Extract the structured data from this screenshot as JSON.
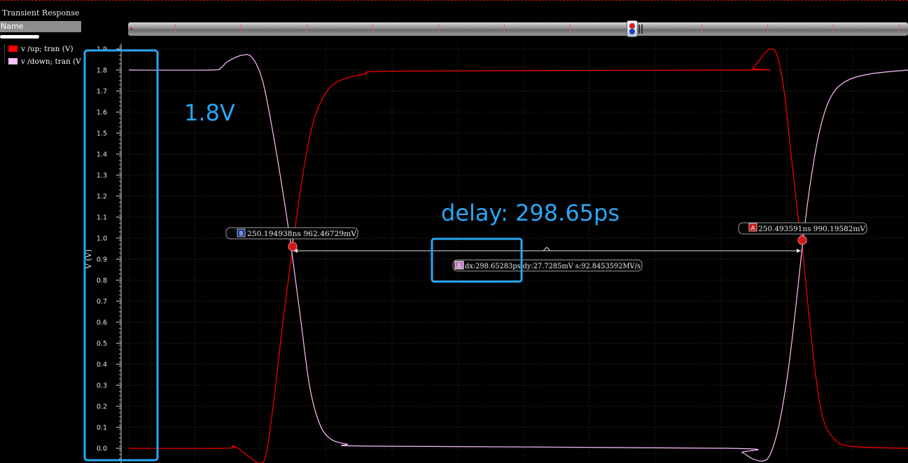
{
  "window": {
    "title": "Transient Response"
  },
  "legend": {
    "header": "Name",
    "items": [
      {
        "label": "v /up; tran (V)",
        "color": "#ff0000"
      },
      {
        "label": "v /down; tran (V",
        "color": "#ffc0ff"
      }
    ]
  },
  "annotations": {
    "voltage_label": "1.8V",
    "delay_label": "delay: 298.65ps"
  },
  "markers": {
    "B": {
      "letter": "B",
      "text": "250.194938ns 962.46729mV",
      "color": "#1a3a9c"
    },
    "A": {
      "letter": "A",
      "text": "250.493591ns 990.19582mV",
      "color": "#cc1a1a"
    },
    "delta": {
      "letter": "Δ",
      "text": "dx:298.65283ps dy:27.7285mV s:92.8453592MV/s",
      "color": "#c070c0"
    }
  },
  "colors": {
    "background": "#000000",
    "up": "#ff0000",
    "down": "#ffc0ff",
    "annotation": "#2aa7f5",
    "grid": "#3a3a3a"
  },
  "chart_data": {
    "type": "line",
    "xlabel": "",
    "ylabel": "V (V)",
    "ylim": [
      0.0,
      1.9
    ],
    "y_ticks": [
      "0.0",
      "0.1",
      "0.2",
      "0.3",
      "0.4",
      "0.5",
      "0.6",
      "0.7",
      "0.8",
      "0.9",
      "1.0",
      "1.1",
      "1.2",
      "1.3",
      "1.4",
      "1.5",
      "1.6",
      "1.7",
      "1.8",
      "1.9"
    ],
    "y_tick_values": [
      0.0,
      0.1,
      0.2,
      0.3,
      0.4,
      0.5,
      0.6,
      0.7,
      0.8,
      0.9,
      1.0,
      1.1,
      1.2,
      1.3,
      1.4,
      1.5,
      1.6,
      1.7,
      1.8,
      1.9
    ],
    "grid": true,
    "legend_position": "left panel",
    "series": [
      {
        "name": "v /up; tran (V)",
        "color": "#ff0000",
        "points": [
          [
            184,
            0
          ],
          [
            320,
            0
          ],
          [
            332,
            0.01
          ],
          [
            340,
            0
          ],
          [
            356,
            -0.04
          ],
          [
            370,
            -0.07
          ],
          [
            380,
            -0.03
          ],
          [
            392,
            0.25
          ],
          [
            404,
            0.6
          ],
          [
            417,
            0.93
          ],
          [
            430,
            1.25
          ],
          [
            445,
            1.52
          ],
          [
            460,
            1.66
          ],
          [
            480,
            1.74
          ],
          [
            520,
            1.78
          ],
          [
            580,
            1.795
          ],
          [
            1060,
            1.8
          ],
          [
            1075,
            1.81
          ],
          [
            1090,
            1.87
          ],
          [
            1100,
            1.9
          ],
          [
            1110,
            1.87
          ],
          [
            1120,
            1.7
          ],
          [
            1130,
            1.4
          ],
          [
            1140,
            1.1
          ],
          [
            1146,
            0.96
          ],
          [
            1155,
            0.65
          ],
          [
            1165,
            0.35
          ],
          [
            1175,
            0.15
          ],
          [
            1190,
            0.05
          ],
          [
            1215,
            0.01
          ],
          [
            1297,
            0
          ]
        ]
      },
      {
        "name": "v /down; tran (V",
        "color": "#ffc0ff",
        "points": [
          [
            184,
            1.8
          ],
          [
            300,
            1.8
          ],
          [
            315,
            1.81
          ],
          [
            325,
            1.84
          ],
          [
            345,
            1.87
          ],
          [
            360,
            1.86
          ],
          [
            375,
            1.75
          ],
          [
            390,
            1.5
          ],
          [
            405,
            1.2
          ],
          [
            417,
            0.93
          ],
          [
            430,
            0.6
          ],
          [
            442,
            0.3
          ],
          [
            455,
            0.13
          ],
          [
            470,
            0.05
          ],
          [
            495,
            0.02
          ],
          [
            540,
            0.01
          ],
          [
            1040,
            0
          ],
          [
            1060,
            -0.02
          ],
          [
            1075,
            -0.05
          ],
          [
            1090,
            -0.06
          ],
          [
            1100,
            -0.03
          ],
          [
            1112,
            0.1
          ],
          [
            1125,
            0.35
          ],
          [
            1136,
            0.65
          ],
          [
            1146,
            0.96
          ],
          [
            1157,
            1.25
          ],
          [
            1170,
            1.5
          ],
          [
            1185,
            1.66
          ],
          [
            1205,
            1.74
          ],
          [
            1240,
            1.78
          ],
          [
            1297,
            1.8
          ]
        ]
      }
    ],
    "cursor_points": {
      "B": {
        "time": "250.194938ns",
        "value_mV": 962.46729
      },
      "A": {
        "time": "250.493591ns",
        "value_mV": 990.19582
      },
      "delta": {
        "dx_ps": 298.65283,
        "dy_mV": 27.7285,
        "slope": "92.8453592MV/s"
      }
    }
  }
}
